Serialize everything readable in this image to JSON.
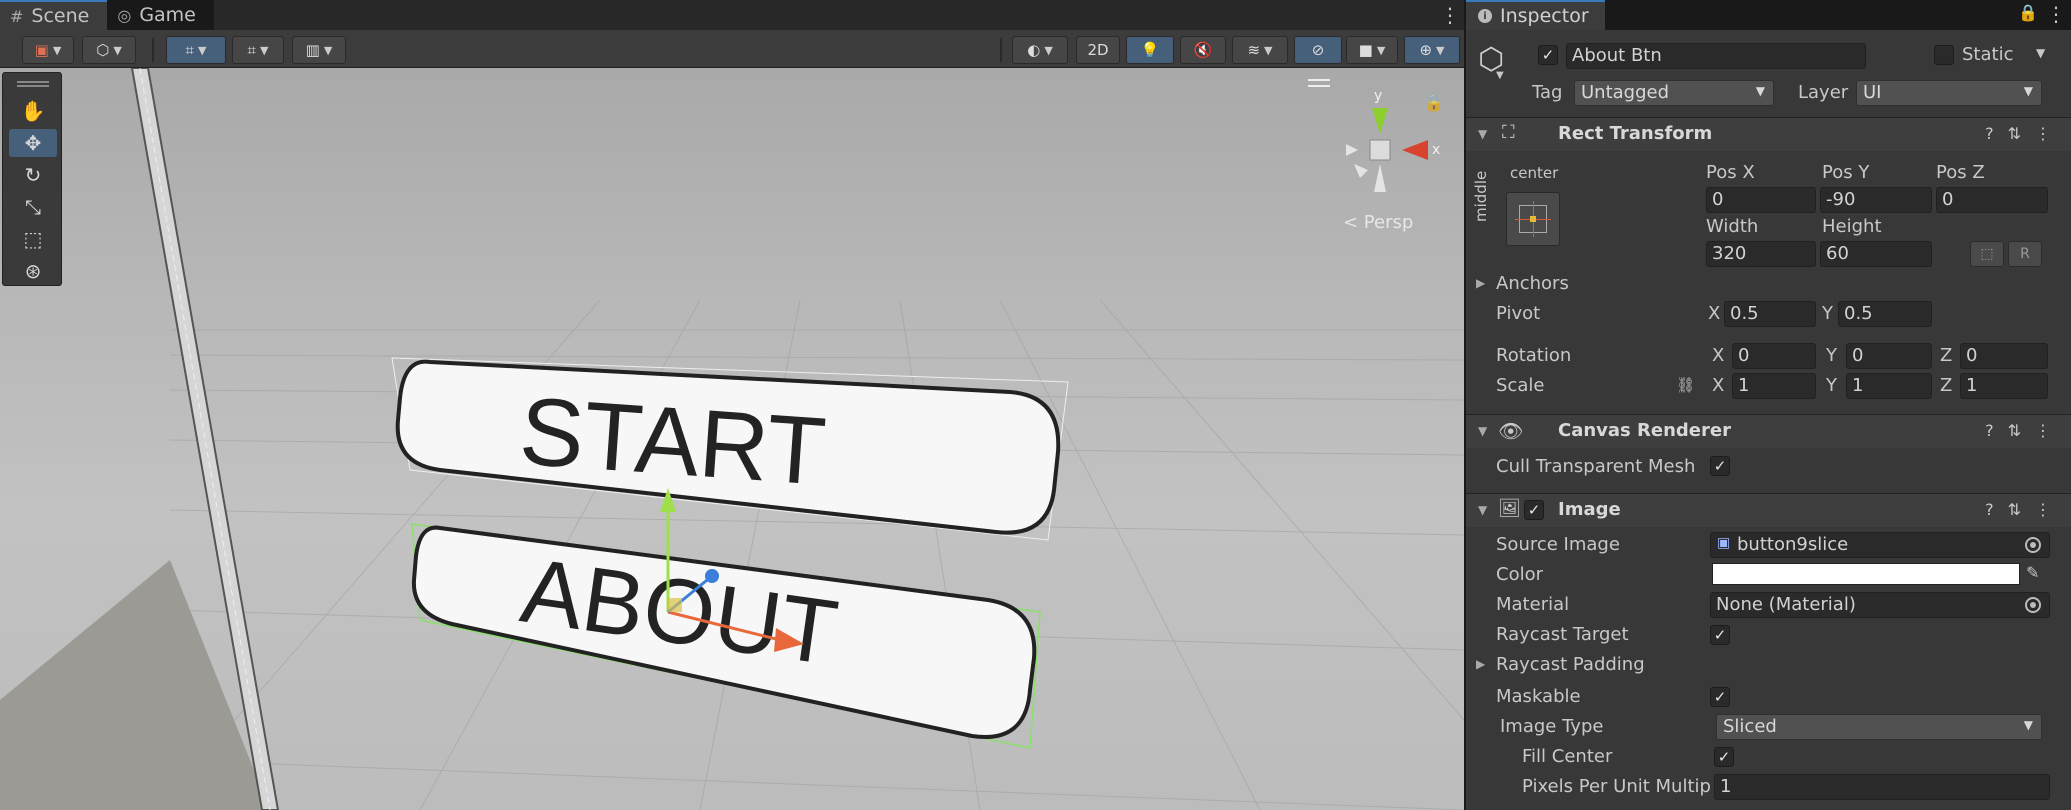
{
  "scene": {
    "tabs": [
      {
        "label": "Scene",
        "icon": "grid-icon"
      },
      {
        "label": "Game",
        "icon": "gamepad-icon"
      }
    ],
    "toolbar": {
      "view_2d_label": "2D"
    },
    "viewport_text": {
      "start": "START",
      "about": "ABOUT",
      "persp": "< Persp",
      "gizmo_x": "x",
      "gizmo_y": "y"
    }
  },
  "inspector": {
    "tab_label": "Inspector",
    "object": {
      "name": "About Btn",
      "static_label": "Static",
      "tag_label": "Tag",
      "tag_value": "Untagged",
      "layer_label": "Layer",
      "layer_value": "UI"
    },
    "rect_transform": {
      "title": "Rect Transform",
      "anchor_h": "center",
      "anchor_v": "middle",
      "pos_x_label": "Pos X",
      "pos_x": "0",
      "pos_y_label": "Pos Y",
      "pos_y": "-90",
      "pos_z_label": "Pos Z",
      "pos_z": "0",
      "width_label": "Width",
      "width": "320",
      "height_label": "Height",
      "height": "60",
      "anchors_label": "Anchors",
      "pivot_label": "Pivot",
      "pivot_x": "0.5",
      "pivot_y": "0.5",
      "rotation_label": "Rotation",
      "rot_x": "0",
      "rot_y": "0",
      "rot_z": "0",
      "scale_label": "Scale",
      "scale_x": "1",
      "scale_y": "1",
      "scale_z": "1",
      "x": "X",
      "y": "Y",
      "z": "Z",
      "r_label": "R"
    },
    "canvas_renderer": {
      "title": "Canvas Renderer",
      "cull_label": "Cull Transparent Mesh",
      "cull_checked": true
    },
    "image": {
      "title": "Image",
      "source_image_label": "Source Image",
      "source_image": "button9slice",
      "color_label": "Color",
      "color_value": "#ffffff",
      "material_label": "Material",
      "material": "None (Material)",
      "raycast_target_label": "Raycast Target",
      "raycast_padding_label": "Raycast Padding",
      "maskable_label": "Maskable",
      "image_type_label": "Image Type",
      "image_type": "Sliced",
      "fill_center_label": "Fill Center",
      "ppu_label": "Pixels Per Unit Multip",
      "ppu": "1"
    }
  },
  "colors": {
    "accent": "#3a79bb",
    "toggle_on": "#46607c",
    "gizmo_x": "#d8432f",
    "gizmo_y": "#8ccf2e",
    "gizmo_z": "#3a7fd9"
  }
}
